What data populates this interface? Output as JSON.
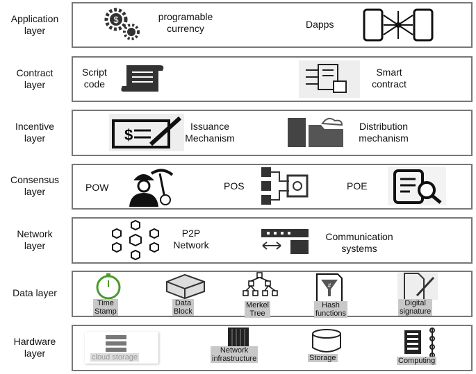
{
  "layers": [
    {
      "label": "Application\nlayer",
      "items": [
        "programable\ncurrency",
        "Dapps"
      ]
    },
    {
      "label": "Contract\nlayer",
      "items": [
        "Script\ncode",
        "Smart\ncontract"
      ]
    },
    {
      "label": "Incentive\nlayer",
      "items": [
        "Issuance\nMechanism",
        "Distribution\nmechanism"
      ]
    },
    {
      "label": "Consensus\nlayer",
      "items": [
        "POW",
        "POS",
        "POE"
      ]
    },
    {
      "label": "Network\nlayer",
      "items": [
        "P2P\nNetwork",
        "Communication\nsystems"
      ]
    },
    {
      "label": "Data layer",
      "items": [
        "Time\nStamp",
        "Data\nBlock",
        "Merkel\nTree",
        "Hash\nfunctions",
        "Digital\nsignature"
      ]
    },
    {
      "label": "Hardware\nlayer",
      "items": [
        "cloud storage",
        "Network\ninfrastructure",
        "Storage",
        "Computing"
      ]
    }
  ],
  "colors": {
    "border": "#777777",
    "caption_bg": "#c8c8c8",
    "timestamp_icon": "#4a9a2a"
  }
}
